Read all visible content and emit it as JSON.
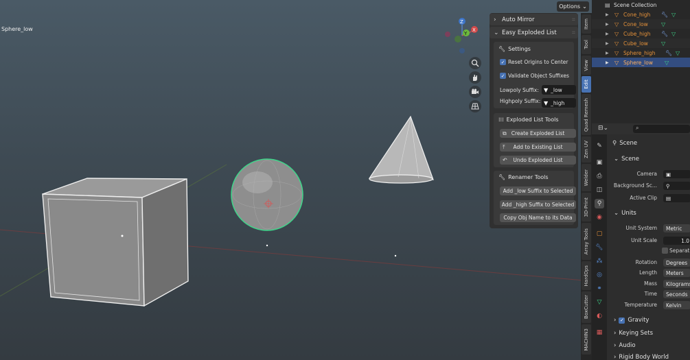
{
  "viewport": {
    "object_name": "Sphere_low",
    "options_label": "Options",
    "gizmo_axes": [
      "Z",
      "Y",
      "X"
    ]
  },
  "npanel": {
    "auto_mirror_title": "Auto Mirror",
    "easy_exploded_title": "Easy Exploded List",
    "settings": {
      "title": "Settings",
      "reset_origins_label": "Reset Origins to Center",
      "validate_suffixes_label": "Validate Object Suffixes",
      "lowpoly_label": "Lowpoly Suffix:",
      "lowpoly_value": "_low",
      "highpoly_label": "Highpoly Suffix:",
      "highpoly_value": "_high"
    },
    "exploded_tools": {
      "title": "Exploded List Tools",
      "create_label": "Create Exploded List",
      "add_label": "Add to Existing List",
      "undo_label": "Undo Exploded List"
    },
    "renamer": {
      "title": "Renamer Tools",
      "add_low_label": "Add _low Suffix to Selected",
      "add_high_label": "Add _high Suffix to Selected",
      "copy_name_label": "Copy Obj Name to its Data"
    }
  },
  "tabs": [
    "Item",
    "Tool",
    "View",
    "Edit",
    "Quad Remesh",
    "Zen UV",
    "Welder",
    "3D-Print",
    "Array Tools",
    "HardOps",
    "BoxCutter",
    "MACHIN3"
  ],
  "outliner": {
    "title": "Scene Collection",
    "items": [
      "Cone_high",
      "Cone_low",
      "Cube_high",
      "Cube_low",
      "Sphere_high",
      "Sphere_low"
    ]
  },
  "properties": {
    "context_label": "Scene",
    "scene_section": "Scene",
    "camera_label": "Camera",
    "background_label": "Background Sc...",
    "active_clip_label": "Active Clip",
    "units_section": "Units",
    "unit_system_label": "Unit System",
    "unit_system_value": "Metric",
    "unit_scale_label": "Unit Scale",
    "unit_scale_value": "1.0",
    "separate_label": "Separat",
    "rotation_label": "Rotation",
    "rotation_value": "Degrees",
    "length_label": "Length",
    "length_value": "Meters",
    "mass_label": "Mass",
    "mass_value": "Kilograms",
    "time_label": "Time",
    "time_value": "Seconds",
    "temperature_label": "Temperature",
    "temperature_value": "Kelvin",
    "gravity_label": "Gravity",
    "keying_sets_label": "Keying Sets",
    "audio_label": "Audio",
    "rigid_body_label": "Rigid Body World"
  },
  "colors": {
    "accent": "#4772b3",
    "selected_row": "#334d80",
    "outliner_name": "#e6923a",
    "selection_outline": "#3ed68a"
  }
}
